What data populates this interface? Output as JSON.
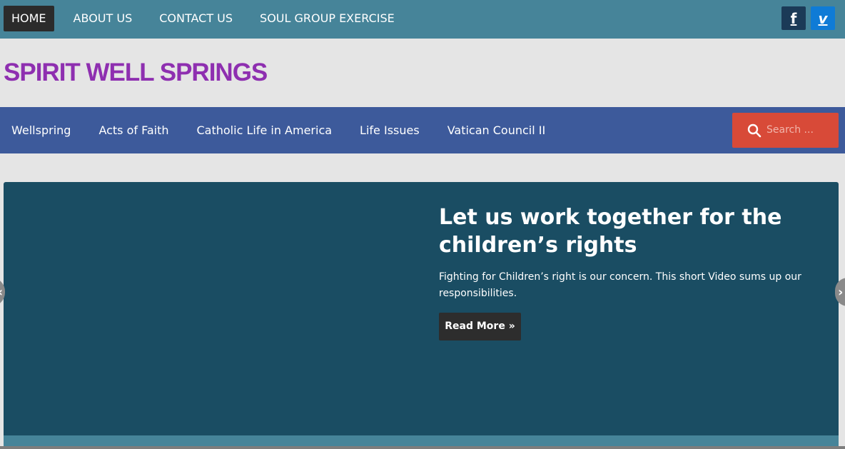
{
  "topbar": {
    "nav": [
      {
        "label": "HOME",
        "active": true
      },
      {
        "label": "ABOUT US",
        "active": false
      },
      {
        "label": "CONTACT US",
        "active": false
      },
      {
        "label": "SOUL GROUP EXERCISE",
        "active": false
      }
    ],
    "social": [
      {
        "icon": "facebook-icon",
        "glyph": "f",
        "color": "#1b3a57"
      },
      {
        "icon": "vimeo-icon",
        "glyph": "v",
        "color": "#0f7bd6"
      }
    ],
    "background": "#468499"
  },
  "header": {
    "site_title": "SPIRIT WELL SPRINGS",
    "title_color": "#8e2fb0"
  },
  "main_nav": {
    "items": [
      {
        "label": "Wellspring"
      },
      {
        "label": "Acts of Faith"
      },
      {
        "label": "Catholic Life in America"
      },
      {
        "label": "Life Issues"
      },
      {
        "label": "Vatican Council II"
      }
    ],
    "background": "#3d5a9b"
  },
  "search": {
    "placeholder": "Search ...",
    "icon": "search-icon",
    "color": "#d84a38"
  },
  "slider": {
    "title": "Let us work together for the children’s rights",
    "description": "Fighting for Children’s right is our concern. This short Video sums up our responsibilities.",
    "button_label": "Read More »",
    "prev_glyph": "‹",
    "next_glyph": "›",
    "background": "#1a4d63"
  }
}
